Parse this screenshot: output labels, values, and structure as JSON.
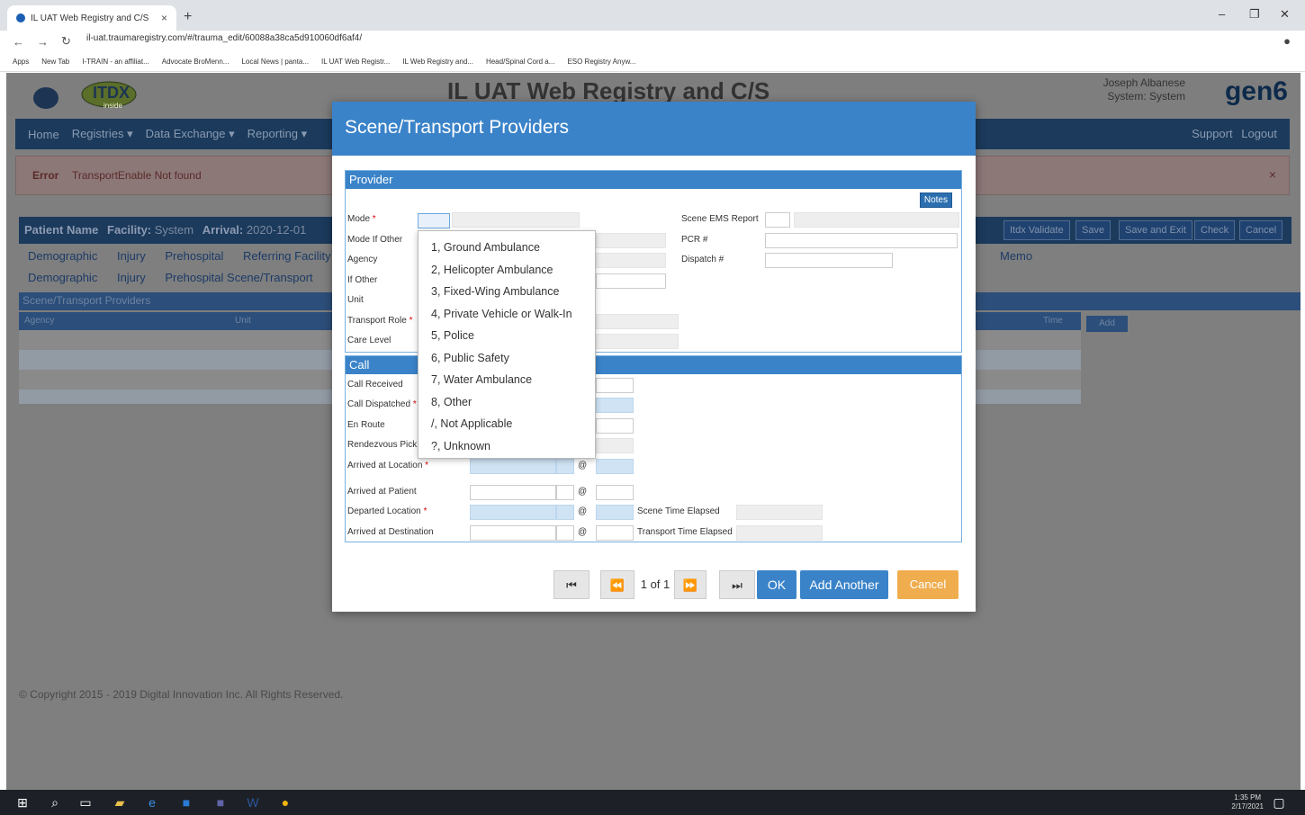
{
  "browser": {
    "tab_title": "IL UAT Web Registry and C/S",
    "url": "il-uat.traumaregistry.com/#/trauma_edit/60088a38ca5d910060df6af4/",
    "bookmarks": [
      "Apps",
      "New Tab",
      "I-TRAIN - an affiliat...",
      "Advocate BroMenn...",
      "Local News | panta...",
      "IL UAT Web Registr...",
      "IL Web Registry and...",
      "Head/Spinal Cord a...",
      "ESO Registry Anyw..."
    ]
  },
  "app": {
    "title": "IL UAT Web Registry and C/S",
    "user_name": "Joseph Albanese",
    "user_system": "System: System",
    "brand": "gen6",
    "logo_text": "ITDX",
    "logo_sub": "inside"
  },
  "nav": {
    "items": [
      "Home",
      "Registries ▾",
      "Data Exchange ▾",
      "Reporting ▾"
    ],
    "support": "Support",
    "logout": "Logout"
  },
  "error": {
    "bold": "Error",
    "text": "TransportEnable Not found",
    "close": "×"
  },
  "patient": {
    "name_label": "Patient Name",
    "facility_label": "Facility:",
    "facility": "System",
    "arrival_label": "Arrival:",
    "arrival": "2020-12-01"
  },
  "actions": [
    "Itdx Validate",
    "Save",
    "Save and Exit",
    "Check",
    "Cancel"
  ],
  "tabs_row1": [
    "Demographic",
    "Injury",
    "Prehospital",
    "Referring Facility"
  ],
  "tabs_row2": [
    "Demographic",
    "Injury",
    "Prehospital Scene/Transport"
  ],
  "memo": "Memo",
  "section_title": "Scene/Transport Providers",
  "table_headers": {
    "agency": "Agency",
    "unit": "Unit",
    "time": "Time"
  },
  "add_label": "Add",
  "copyright": "© Copyright 2015 - 2019 Digital Innovation Inc. All Rights Reserved.",
  "modal": {
    "title": "Scene/Transport Providers",
    "provider_header": "Provider",
    "notes": "Notes",
    "labels": {
      "mode": "Mode",
      "mode_other": "Mode If Other",
      "agency": "Agency",
      "if_other": "If Other",
      "unit": "Unit",
      "transport_role": "Transport Role",
      "care_level": "Care Level",
      "scene_ems": "Scene EMS Report",
      "pcr": "PCR #",
      "dispatch": "Dispatch #"
    },
    "call_header": "Call",
    "call_labels": {
      "received": "Call Received",
      "dispatched": "Call Dispatched",
      "en_route": "En Route",
      "rendezvous": "Rendezvous Pick",
      "arrived_location": "Arrived at Location",
      "arrived_patient": "Arrived at Patient",
      "departed": "Departed Location",
      "arrived_dest": "Arrived at Destination",
      "scene_elapsed": "Scene Time Elapsed",
      "transport_elapsed": "Transport Time Elapsed"
    },
    "at_symbol": "@",
    "pager": {
      "first": "⏮",
      "prev": "⏪",
      "text": "1 of 1",
      "next": "⏩",
      "last": "⏭"
    },
    "ok": "OK",
    "add_another": "Add Another",
    "cancel": "Cancel"
  },
  "mode_options": [
    "1, Ground Ambulance",
    "2, Helicopter Ambulance",
    "3, Fixed-Wing Ambulance",
    "4, Private Vehicle or Walk-In",
    "5, Police",
    "6, Public Safety",
    "7, Water Ambulance",
    "8, Other",
    "/, Not Applicable",
    "?, Unknown"
  ],
  "taskbar": {
    "time": "1:35 PM",
    "date": "2/17/2021"
  }
}
